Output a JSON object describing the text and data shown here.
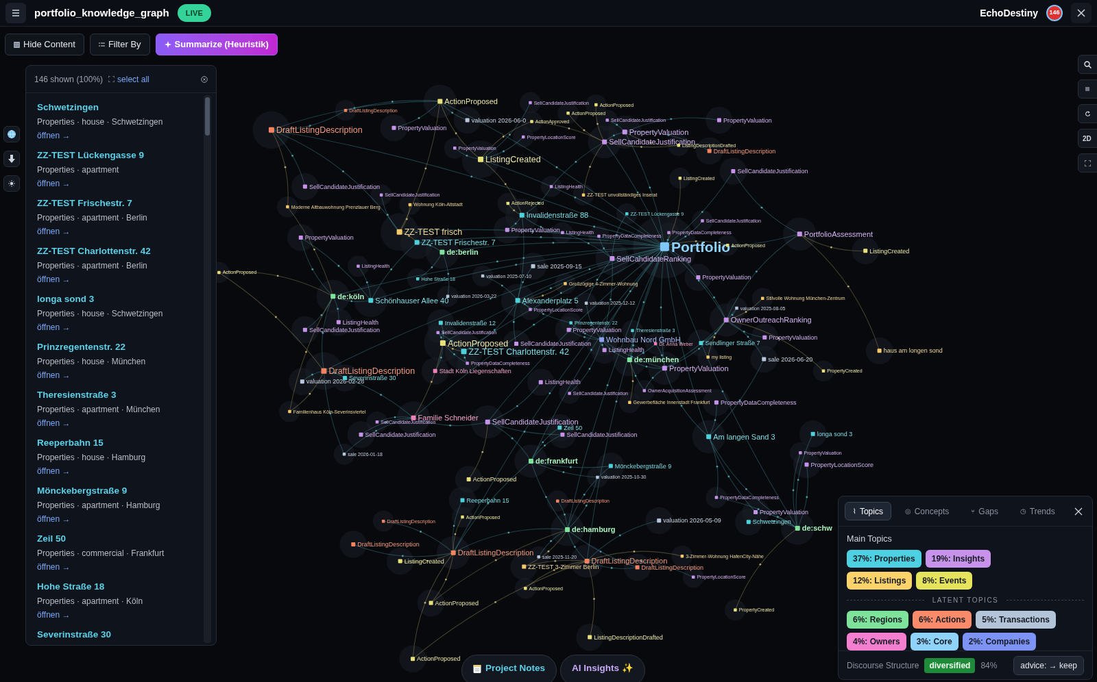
{
  "header": {
    "title": "portfolio_knowledge_graph",
    "live_badge": "LIVE",
    "user": "EchoDestiny",
    "notification_count": "146"
  },
  "toolbar": [
    {
      "kind": "toggle",
      "label": "Hide Content"
    },
    {
      "kind": "filter",
      "label": "Filter By"
    },
    {
      "kind": "summarize",
      "label": "Summarize (Heuristik)"
    }
  ],
  "list_panel": {
    "count": "146 shown (100%)",
    "select_all": "select all",
    "items": [
      {
        "title": "Schwetzingen",
        "meta": "Properties · house · Schwetzingen",
        "link": "öffnen →"
      },
      {
        "title": "ZZ-TEST Lückengasse 9",
        "meta": "Properties · apartment",
        "link": "öffnen →"
      },
      {
        "title": "ZZ-TEST Frischestr. 7",
        "meta": "Properties · apartment · Berlin",
        "link": "öffnen →"
      },
      {
        "title": "ZZ-TEST Charlottenstr. 42",
        "meta": "Properties · apartment · Berlin",
        "link": "öffnen →"
      },
      {
        "title": "longa sond 3",
        "meta": "Properties · house · Schwetzingen",
        "link": "öffnen →"
      },
      {
        "title": "Prinzregentenstr. 22",
        "meta": "Properties · house · München",
        "link": "öffnen →"
      },
      {
        "title": "Theresienstraße 3",
        "meta": "Properties · apartment · München",
        "link": "öffnen →"
      },
      {
        "title": "Reeperbahn 15",
        "meta": "Properties · house · Hamburg",
        "link": "öffnen →"
      },
      {
        "title": "Mönckebergstraße 9",
        "meta": "Properties · apartment · Hamburg",
        "link": "öffnen →"
      },
      {
        "title": "Zeil 50",
        "meta": "Properties · commercial · Frankfurt",
        "link": "öffnen →"
      },
      {
        "title": "Hohe Straße 18",
        "meta": "Properties · apartment · Köln",
        "link": "öffnen →"
      },
      {
        "title": "Severinstraße 30"
      }
    ]
  },
  "graph": {
    "nodes": [
      {
        "label": "ActionProposed",
        "kind": "event"
      },
      {
        "label": "SellCandidateJustification",
        "kind": "insight"
      },
      {
        "label": "ActionProposed",
        "kind": "event"
      },
      {
        "label": "DraftListingDescription",
        "kind": "action"
      },
      {
        "label": "ActionProposed",
        "kind": "event"
      },
      {
        "label": "valuation 2026-06-0",
        "kind": "transaction"
      },
      {
        "label": "ActionApproved",
        "kind": "event"
      },
      {
        "label": "SellCandidateJustification",
        "kind": "insight"
      },
      {
        "label": "PropertyValuation",
        "kind": "insight"
      },
      {
        "label": "DraftListingDescription",
        "kind": "action"
      },
      {
        "label": "PropertyValuation",
        "kind": "insight"
      },
      {
        "label": "PropertyLocationScore",
        "kind": "insight"
      },
      {
        "label": "PropertyValuation",
        "kind": "insight"
      },
      {
        "label": "SellCandidateJustification",
        "kind": "insight"
      },
      {
        "label": "PropertyValuation",
        "kind": "insight"
      },
      {
        "label": "ListingDescriptionDrafted",
        "kind": "event"
      },
      {
        "label": "DraftListingDescription",
        "kind": "action"
      },
      {
        "label": "ListingCreated",
        "kind": "event"
      },
      {
        "label": "SellCandidateJustification",
        "kind": "insight"
      },
      {
        "label": "ListingCreated",
        "kind": "event"
      },
      {
        "label": "SellCandidateJustification",
        "kind": "insight"
      },
      {
        "label": "ListingHealth",
        "kind": "insight"
      },
      {
        "label": "SellCandidateJustification",
        "kind": "insight"
      },
      {
        "label": "ZZ-TEST unvollständiges Inserat",
        "kind": "listing"
      },
      {
        "label": "Moderne Altbauwohnung Prenzlauer Berg",
        "kind": "listing"
      },
      {
        "label": "Wohnung Köln-Altstadt",
        "kind": "listing"
      },
      {
        "label": "ActionRejected",
        "kind": "event"
      },
      {
        "label": "Invalidenstraße 88",
        "kind": "property"
      },
      {
        "label": "ZZ-TEST Lückengasse 9",
        "kind": "property"
      },
      {
        "label": "SellCandidateJustification",
        "kind": "insight"
      },
      {
        "label": "PropertyValuation",
        "kind": "insight"
      },
      {
        "label": "ZZ-TEST frisch",
        "kind": "listing"
      },
      {
        "label": "PropertyValuation",
        "kind": "insight"
      },
      {
        "label": "ListingHealth",
        "kind": "insight"
      },
      {
        "label": "PropertyDataCompleteness",
        "kind": "insight"
      },
      {
        "label": "PropertyDataCompleteness",
        "kind": "insight"
      },
      {
        "label": "PortfolioAssessment",
        "kind": "insight"
      },
      {
        "label": "ZZ-TEST Frischestr. 7",
        "kind": "property"
      },
      {
        "label": "de:berlin",
        "kind": "region"
      },
      {
        "label": "Portfolio",
        "kind": "core"
      },
      {
        "label": "ActionProposed",
        "kind": "event"
      },
      {
        "label": "ListingCreated",
        "kind": "event"
      },
      {
        "label": "SellCandidateRanking",
        "kind": "insight"
      },
      {
        "label": "ListingHealth",
        "kind": "insight"
      },
      {
        "label": "sale 2025-09-15",
        "kind": "transaction"
      },
      {
        "label": "ActionProposed",
        "kind": "event"
      },
      {
        "label": "Hohe Straße 18",
        "kind": "property"
      },
      {
        "label": "valuation 2025-07-10",
        "kind": "transaction"
      },
      {
        "label": "PropertyValuation",
        "kind": "insight"
      },
      {
        "label": "Großzügige 4-Zimmer-Wohnung",
        "kind": "listing"
      },
      {
        "label": "de:köln",
        "kind": "region"
      },
      {
        "label": "Schönhauser Allee 40",
        "kind": "property"
      },
      {
        "label": "valuation 2026-03-22",
        "kind": "transaction"
      },
      {
        "label": "Alexanderplatz 5",
        "kind": "property"
      },
      {
        "label": "valuation 2025-12-12",
        "kind": "transaction"
      },
      {
        "label": "Stilvolle Wohnung München-Zentrum",
        "kind": "listing"
      },
      {
        "label": "PropertyLocationScore",
        "kind": "insight"
      },
      {
        "label": "valuation 2025-08-05",
        "kind": "transaction"
      },
      {
        "label": "ListingHealth",
        "kind": "insight"
      },
      {
        "label": "Invalidenstraße 12",
        "kind": "property"
      },
      {
        "label": "Prinzregentenstr. 22",
        "kind": "property"
      },
      {
        "label": "OwnerOutreachRanking",
        "kind": "insight"
      },
      {
        "label": "SellCandidateJustification",
        "kind": "insight"
      },
      {
        "label": "SellCandidateJustification",
        "kind": "insight"
      },
      {
        "label": "PropertyValuation",
        "kind": "insight"
      },
      {
        "label": "Theresienstraße 3",
        "kind": "property"
      },
      {
        "label": "ActionProposed",
        "kind": "event"
      },
      {
        "label": "SellCandidateJustification",
        "kind": "insight"
      },
      {
        "label": "Wohnbau Nord GmbH",
        "kind": "company"
      },
      {
        "label": "Dr. Anna Weber",
        "kind": "owner"
      },
      {
        "label": "Sendlinger Straße 7",
        "kind": "property"
      },
      {
        "label": "PropertyValuation",
        "kind": "insight"
      },
      {
        "label": "ZZ-TEST Charlottenstr. 42",
        "kind": "property"
      },
      {
        "label": "ListingHealth",
        "kind": "insight"
      },
      {
        "label": "haus am longen sond",
        "kind": "listing"
      },
      {
        "label": "PropertyDataCompleteness",
        "kind": "insight"
      },
      {
        "label": "de:münchen",
        "kind": "region"
      },
      {
        "label": "my listing",
        "kind": "listing"
      },
      {
        "label": "sale 2026-06-20",
        "kind": "transaction"
      },
      {
        "label": "DraftListingDescription",
        "kind": "action"
      },
      {
        "label": "Stadt Köln Liegenschaften",
        "kind": "owner"
      },
      {
        "label": "PropertyValuation",
        "kind": "insight"
      },
      {
        "label": "PropertyCreated",
        "kind": "event"
      },
      {
        "label": "valuation 2026-02-28",
        "kind": "transaction"
      },
      {
        "label": "Severinstraße 30",
        "kind": "property"
      },
      {
        "label": "ListingHealth",
        "kind": "insight"
      },
      {
        "label": "SellCandidateJustification",
        "kind": "insight"
      },
      {
        "label": "OwnerAcquisitionAssessment",
        "kind": "insight"
      },
      {
        "label": "Gewerbefläche Innenstadt Frankfurt",
        "kind": "listing"
      },
      {
        "label": "PropertyDataCompleteness",
        "kind": "insight"
      },
      {
        "label": "Familienhaus Köln-Severinsviertel",
        "kind": "listing"
      },
      {
        "label": "SellCandidateJustification",
        "kind": "insight"
      },
      {
        "label": "Familie Schneider",
        "kind": "owner"
      },
      {
        "label": "SellCandidateJustification",
        "kind": "insight"
      },
      {
        "label": "Zeil 50",
        "kind": "property"
      },
      {
        "label": "SellCandidateJustification",
        "kind": "insight"
      },
      {
        "label": "SellCandidateJustification",
        "kind": "insight"
      },
      {
        "label": "Am langen Sand 3",
        "kind": "property"
      },
      {
        "label": "longa sond 3",
        "kind": "property"
      },
      {
        "label": "sale 2026-01-18",
        "kind": "transaction"
      },
      {
        "label": "PropertyValuation",
        "kind": "insight"
      },
      {
        "label": "de:frankfurt",
        "kind": "region"
      },
      {
        "label": "Mönckebergstraße 9",
        "kind": "property"
      },
      {
        "label": "PropertyLocationScore",
        "kind": "insight"
      },
      {
        "label": "ActionProposed",
        "kind": "event"
      },
      {
        "label": "valuation 2025-10-30",
        "kind": "transaction"
      },
      {
        "label": "Reeperbahn 15",
        "kind": "property"
      },
      {
        "label": "DraftListingDescription",
        "kind": "action"
      },
      {
        "label": "PropertyDataCompleteness",
        "kind": "insight"
      },
      {
        "label": "DraftListingDescription",
        "kind": "action"
      },
      {
        "label": "ActionProposed",
        "kind": "event"
      },
      {
        "label": "PropertyValuation",
        "kind": "insight"
      },
      {
        "label": "valuation 2026-05-09",
        "kind": "transaction"
      },
      {
        "label": "Schwetzingen",
        "kind": "property"
      },
      {
        "label": "de:hamburg",
        "kind": "region"
      },
      {
        "label": "de:schw",
        "kind": "region"
      },
      {
        "label": "DraftListingDescription",
        "kind": "action"
      },
      {
        "label": "DraftListingDescription",
        "kind": "action"
      },
      {
        "label": "ListingCreated",
        "kind": "event"
      },
      {
        "label": "sale 2025-11-20",
        "kind": "transaction"
      },
      {
        "label": "ZZ-TEST 3-Zimmer Berlin",
        "kind": "listing"
      },
      {
        "label": "DraftListingDescription",
        "kind": "action"
      },
      {
        "label": "3-Zimmer-Wohnung HafenCity-Nähe",
        "kind": "listing"
      },
      {
        "label": "DraftListingDescription",
        "kind": "action"
      },
      {
        "label": "PropertyLocationScore",
        "kind": "insight"
      },
      {
        "label": "ActionProposed",
        "kind": "event"
      },
      {
        "label": "ActionProposed",
        "kind": "event"
      },
      {
        "label": "PropertyCreated",
        "kind": "event"
      },
      {
        "label": "ListingDescriptionDrafted",
        "kind": "event"
      },
      {
        "label": "ActionProposed",
        "kind": "event"
      }
    ]
  },
  "view_controls": {
    "mode": "2D"
  },
  "insights_panel": {
    "tabs": [
      {
        "icon": "⌇",
        "label": "Topics",
        "selected": true
      },
      {
        "icon": "◎",
        "label": "Concepts",
        "selected": false
      },
      {
        "icon": "⑂",
        "label": "Gaps",
        "selected": false
      },
      {
        "icon": "◷",
        "label": "Trends",
        "selected": false
      }
    ],
    "main_heading": "Main Topics",
    "main_topics": [
      {
        "label": "37%: Properties",
        "color": "#4dd0e1"
      },
      {
        "label": "19%: Insights",
        "color": "#c792ea"
      },
      {
        "label": "12%: Listings",
        "color": "#fcd36b"
      },
      {
        "label": "8%: Events",
        "color": "#e6e35c"
      }
    ],
    "latent_heading": "LATENT TOPICS",
    "latent_topics": [
      {
        "label": "6%: Regions",
        "color": "#7ee29a"
      },
      {
        "label": "6%: Actions",
        "color": "#f98a6a"
      },
      {
        "label": "5%: Transactions",
        "color": "#b4c4d8"
      },
      {
        "label": "4%: Owners",
        "color": "#f47fd0"
      },
      {
        "label": "3%: Core",
        "color": "#8fd3fb"
      },
      {
        "label": "2%: Companies",
        "color": "#7c93f5"
      }
    ],
    "discourse_label": "Discourse Structure",
    "discourse_value": "diversified",
    "discourse_score": "84%",
    "advice": "advice: → keep"
  },
  "bottom_buttons": [
    {
      "kind": "notes",
      "label": "Project Notes"
    },
    {
      "kind": "ai",
      "label": "AI Insights ✨"
    }
  ]
}
